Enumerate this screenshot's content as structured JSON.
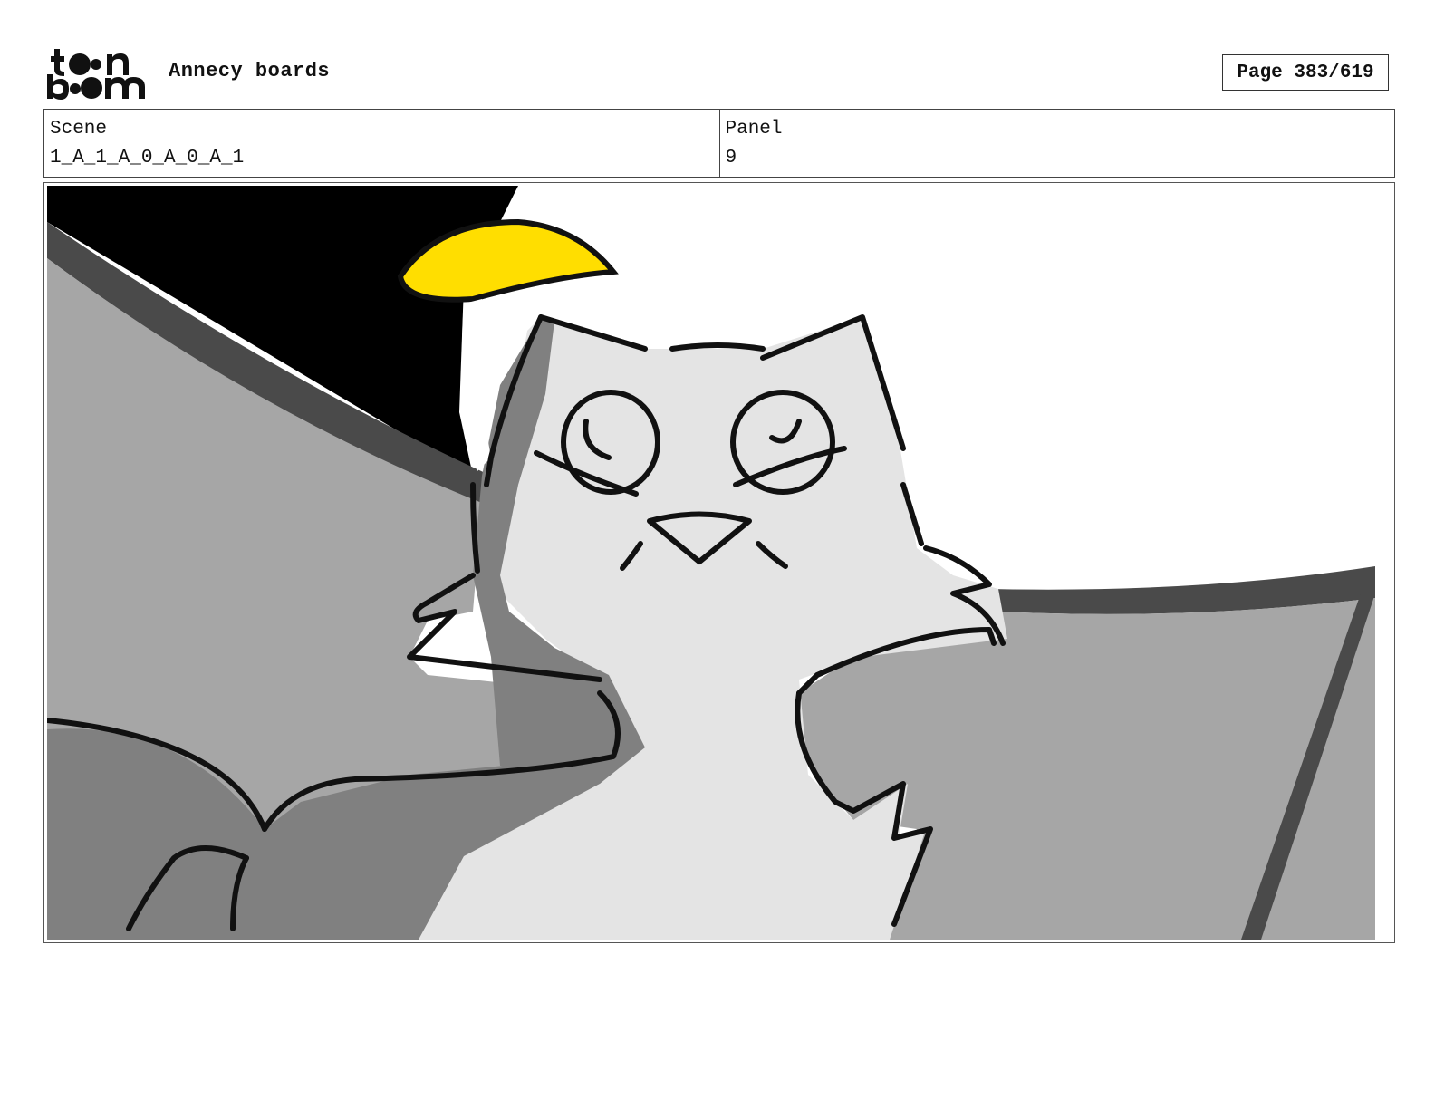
{
  "header": {
    "logo_text": "toon boom",
    "title": "Annecy boards",
    "page_label": "Page",
    "page_number": "383/619"
  },
  "info": {
    "scene_label": "Scene",
    "scene_value": "1_A_1_A_0_A_0_A_1",
    "panel_label": "Panel",
    "panel_value": "9"
  },
  "colors": {
    "accent_yellow": "#ffde00",
    "light_gray": "#e4e4e4",
    "mid_gray": "#a6a6a6",
    "dark_gray": "#808080",
    "shadow_gray": "#4a4a4a"
  }
}
